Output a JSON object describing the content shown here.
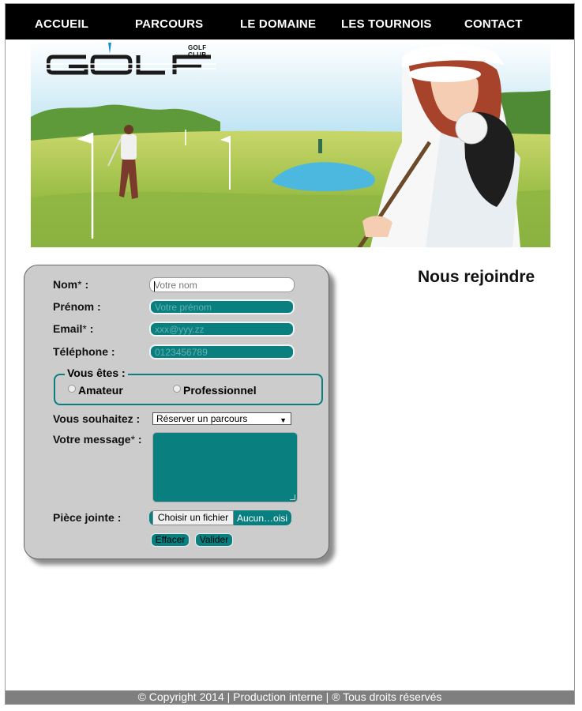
{
  "nav": {
    "items": [
      "ACCUEIL",
      "PARCOURS",
      "LE DOMAINE",
      "LES TOURNOIS",
      "CONTACT"
    ]
  },
  "banner": {
    "logo_text": "GOLF",
    "logo_sub": "GOLF CLUB"
  },
  "page": {
    "title": "Nous rejoindre"
  },
  "form": {
    "nom": {
      "label": "Nom",
      "req": "*",
      "suffix": " :",
      "placeholder": "Votre nom"
    },
    "prenom": {
      "label": "Prénom :",
      "placeholder": "Votre prénom"
    },
    "email": {
      "label": "Email",
      "req": "*",
      "suffix": " :",
      "placeholder": "xxx@yyy.zz"
    },
    "telephone": {
      "label": "Téléphone :",
      "placeholder": "0123456789"
    },
    "vous_etes": {
      "legend": "Vous êtes :",
      "options": [
        "Amateur",
        "Professionnel"
      ]
    },
    "souhaitez": {
      "label": "Vous souhaitez :",
      "selected": "Réserver un parcours"
    },
    "message": {
      "label": "Votre message",
      "req": "*",
      "suffix": " :"
    },
    "piece_jointe": {
      "label": "Pièce jointe :",
      "button": "Choisir un fichier",
      "filename": "Aucun…oisi"
    },
    "buttons": {
      "reset": "Effacer",
      "submit": "Valider"
    }
  },
  "footer": {
    "text": "© Copyright 2014 | Production interne | ® Tous droits réservés"
  },
  "colors": {
    "accent": "#0a7f7f",
    "nav_bg": "#000000",
    "form_bg": "#cccccc",
    "footer_bg": "#7f7f7f"
  }
}
